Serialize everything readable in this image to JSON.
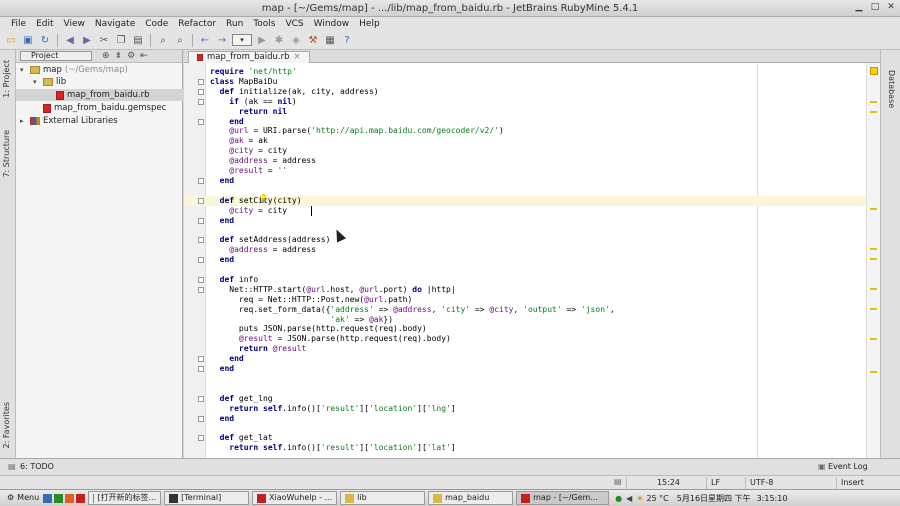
{
  "window": {
    "title": "map - [~/Gems/map] - .../lib/map_from_baidu.rb - JetBrains RubyMine 5.4.1"
  },
  "menu": [
    "File",
    "Edit",
    "View",
    "Navigate",
    "Code",
    "Refactor",
    "Run",
    "Tools",
    "VCS",
    "Window",
    "Help"
  ],
  "side_tabs": {
    "project": "1: Project",
    "structure": "7: Structure",
    "favorites": "2: Favorites",
    "database": "Database"
  },
  "project_panel": {
    "view_selector": "Project",
    "tree": [
      {
        "label": "map",
        "hint": "(~/Gems/map)",
        "type": "folder",
        "level": 0
      },
      {
        "label": "lib",
        "hint": "",
        "type": "folder",
        "level": 1
      },
      {
        "label": "map_from_baidu.rb",
        "hint": "",
        "type": "rb",
        "level": 2,
        "selected": true
      },
      {
        "label": "map_from_baidu.gemspec",
        "hint": "",
        "type": "rb",
        "level": 1
      },
      {
        "label": "External Libraries",
        "hint": "",
        "type": "lib",
        "level": 0
      }
    ]
  },
  "editor": {
    "tab_label": "map_from_baidu.rb",
    "lines": [
      "require 'net/http'",
      "class MapBaiDu",
      "  def initialize(ak, city, address)",
      "    if (ak == nil)",
      "      return nil",
      "    end",
      "    @url = URI.parse('http://api.map.baidu.com/geocoder/v2/')",
      "    @ak = ak",
      "    @city = city",
      "    @address = address",
      "    @result = ''",
      "  end",
      "",
      "  def setCity(city)",
      "    @city = city",
      "  end",
      "",
      "  def setAddress(address)",
      "    @address = address",
      "  end",
      "",
      "  def info",
      "    Net::HTTP.start(@url.host, @url.port) do |http|",
      "      req = Net::HTTP::Post.new(@url.path)",
      "      req.set_form_data({'address' => @address, 'city' => @city, 'output' => 'json',",
      "                         'ak' => @ak})",
      "      puts JSON.parse(http.request(req).body)",
      "      @result = JSON.parse(http.request(req).body)",
      "      return @result",
      "    end",
      "  end",
      "",
      "",
      "  def get_lng",
      "    return self.info()['result']['location']['lng']",
      "  end",
      "",
      "  def get_lat",
      "    return self.info()['result']['location']['lat']"
    ]
  },
  "status": {
    "todo": "6: TODO",
    "event_log": "Event Log",
    "position": "15:24",
    "line_sep": "LF",
    "encoding": "UTF-8",
    "mode": "Insert"
  },
  "taskbar": {
    "menu_label": "Menu",
    "tasks": [
      "[打开新的标签...",
      "[Terminal]",
      "XiaoWuhelp - ...",
      "lib",
      "map_baidu",
      "map - [~/Gem..."
    ],
    "weather": "25 °C",
    "date": "5月16日星期四 下午",
    "time": "3:15:10"
  },
  "colors": {
    "caret_line": "#fbf6d9",
    "keyword": "#000080",
    "string": "#067d17",
    "ivar": "#660e7a"
  }
}
